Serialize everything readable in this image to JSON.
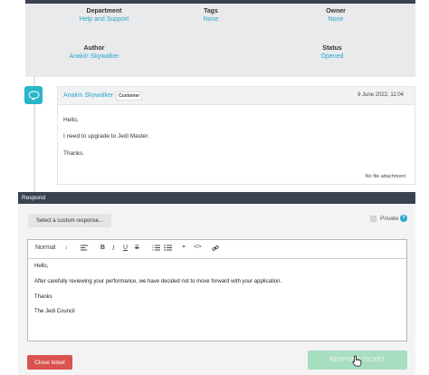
{
  "ticket_info": {
    "department": {
      "label": "Department",
      "value": "Help and Support"
    },
    "tags": {
      "label": "Tags",
      "value": "None"
    },
    "owner": {
      "label": "Owner",
      "value": "None"
    },
    "author": {
      "label": "Author",
      "value": "Anakin Skywalker"
    },
    "status": {
      "label": "Status",
      "value": "Opened"
    }
  },
  "message": {
    "author": "Anakin Skywalker",
    "role": "Customer",
    "date": "9 June 2022, 11:04",
    "lines": [
      "Hello,",
      "I need to upgrade to Jedi Master.",
      "Thanks."
    ],
    "attachment": "No file attachment"
  },
  "respond": {
    "title": "Respond",
    "canned_label": "Select a custom response...",
    "private_label": "Private",
    "help_glyph": "?",
    "toolbar": {
      "format": "Normal"
    },
    "editor_lines": [
      "Hello,",
      "After carefully reviewing your performance, we have decided not to move forward with your application.",
      "Thanks",
      "The Jedi Council"
    ],
    "close_label": "Close ticket",
    "respond_label": "RESPOND TICKET"
  },
  "colors": {
    "accent": "#2aa7c9",
    "danger": "#d9534f",
    "success_disabled": "#a8dec0",
    "header_dark": "#3a4250"
  },
  "icons": [
    "chat-bubble-icon",
    "align-left-icon",
    "ordered-list-icon",
    "bullet-list-icon",
    "quote-icon",
    "code-icon",
    "link-icon",
    "help-icon",
    "hand-cursor-icon"
  ]
}
